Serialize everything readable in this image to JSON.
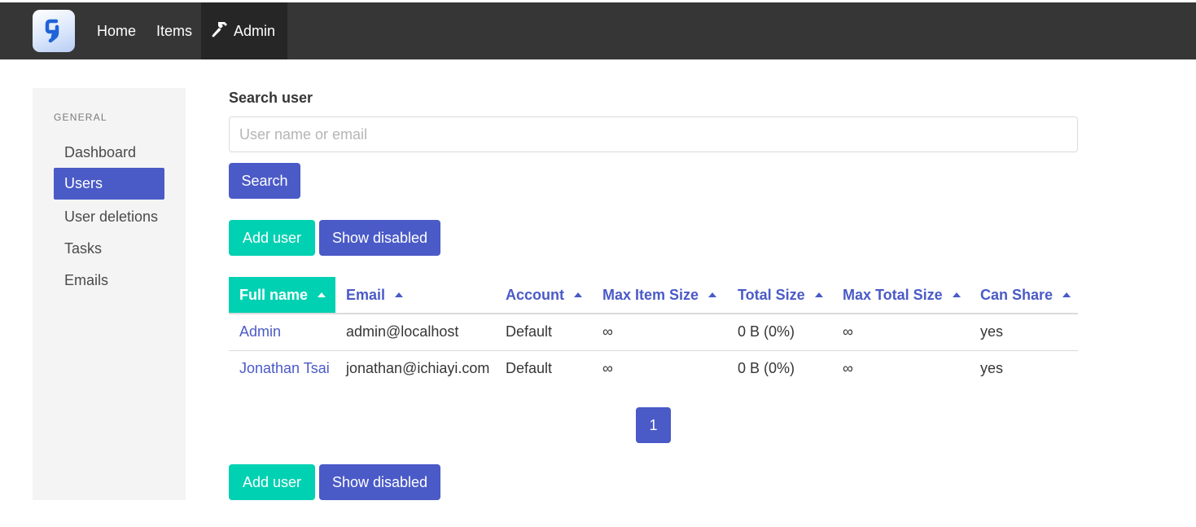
{
  "nav": {
    "logo_icon": "app-logo-icon",
    "links": [
      {
        "label": "Home"
      },
      {
        "label": "Items"
      },
      {
        "label": "Admin",
        "icon": "hammer-icon",
        "active": true
      }
    ]
  },
  "sidebar": {
    "section_label": "GENERAL",
    "items": [
      {
        "label": "Dashboard",
        "active": false
      },
      {
        "label": "Users",
        "active": true
      },
      {
        "label": "User deletions",
        "active": false
      },
      {
        "label": "Tasks",
        "active": false
      },
      {
        "label": "Emails",
        "active": false
      }
    ]
  },
  "search": {
    "label": "Search user",
    "placeholder": "User name or email",
    "value": "",
    "button_label": "Search"
  },
  "actions": {
    "add_user_label": "Add user",
    "show_disabled_label": "Show disabled"
  },
  "table": {
    "columns": [
      "Full name",
      "Email",
      "Account",
      "Max Item Size",
      "Total Size",
      "Max Total Size",
      "Can Share"
    ],
    "sorted_column": "Full name",
    "rows": [
      [
        "Admin",
        "admin@localhost",
        "Default",
        "∞",
        "0 B (0%)",
        "∞",
        "yes"
      ],
      [
        "Jonathan Tsai",
        "jonathan@ichiayi.com",
        "Default",
        "∞",
        "0 B (0%)",
        "∞",
        "yes"
      ]
    ]
  },
  "pagination": {
    "current_page": "1"
  },
  "colors": {
    "primary": "#4a5ac7",
    "teal": "#00d1b2",
    "navbar": "#363636"
  }
}
